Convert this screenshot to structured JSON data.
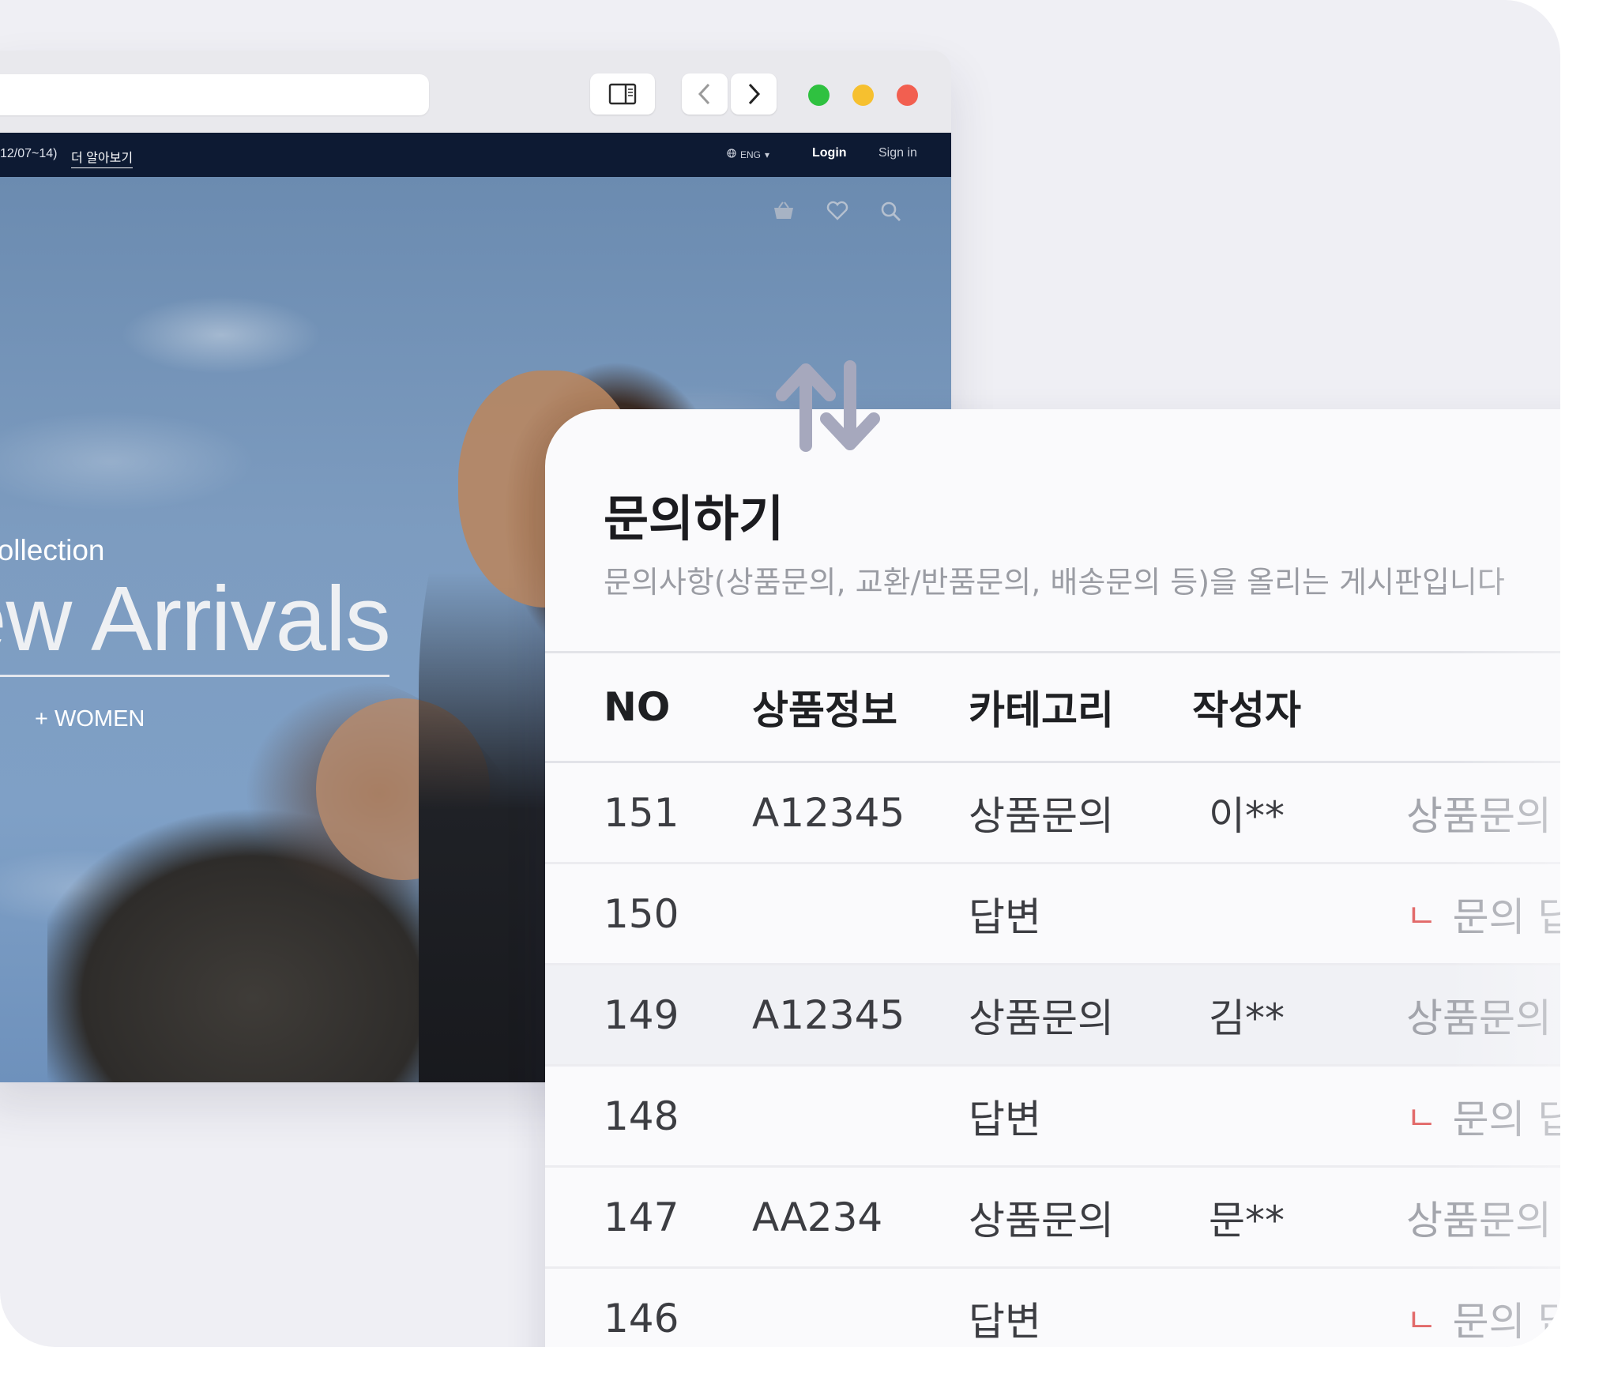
{
  "browser": {
    "toolbar": {
      "sidebar_icon": "sidebar-toggle-icon",
      "back_icon": "chevron-left-icon",
      "forward_icon": "chevron-right-icon",
      "traffic_lights": {
        "green": "#2fc140",
        "yellow": "#f6c02f",
        "red": "#f25f50"
      }
    },
    "site_nav": {
      "promo_text": "12/07~14)",
      "promo_link": "더 알아보기",
      "language": "ENG",
      "login": "Login",
      "signin": "Sign in",
      "background": "#0d1a33"
    },
    "hero": {
      "icons": [
        "basket-icon",
        "heart-icon",
        "search-icon"
      ],
      "subtitle": "Collection",
      "title": "ew Arrivals",
      "link": "+ WOMEN"
    }
  },
  "swap_icon": "swap-vertical-arrows-icon",
  "inquiry": {
    "title": "문의하기",
    "description": "문의사항(상품문의, 교환/반품문의, 배송문의 등)을 올리는 게시판입니다",
    "columns": [
      "NO",
      "상품정보",
      "카테고리",
      "작성자"
    ],
    "rows": [
      {
        "no": "151",
        "product": "A12345",
        "category": "상품문의",
        "author": "이**",
        "title": "상품문의",
        "reply": false
      },
      {
        "no": "150",
        "product": "",
        "category": "답변",
        "author": "",
        "title": "문의 답",
        "reply": true
      },
      {
        "no": "149",
        "product": "A12345",
        "category": "상품문의",
        "author": "김**",
        "title": "상품문의",
        "reply": false
      },
      {
        "no": "148",
        "product": "",
        "category": "답변",
        "author": "",
        "title": "문의 답",
        "reply": true
      },
      {
        "no": "147",
        "product": "AA234",
        "category": "상품문의",
        "author": "문**",
        "title": "상품문의",
        "reply": false
      },
      {
        "no": "146",
        "product": "",
        "category": "답변",
        "author": "",
        "title": "문의 답",
        "reply": true
      }
    ],
    "reply_marker": "ㄴ",
    "reply_marker_color": "#e26a6a",
    "highlight_row": "149"
  }
}
